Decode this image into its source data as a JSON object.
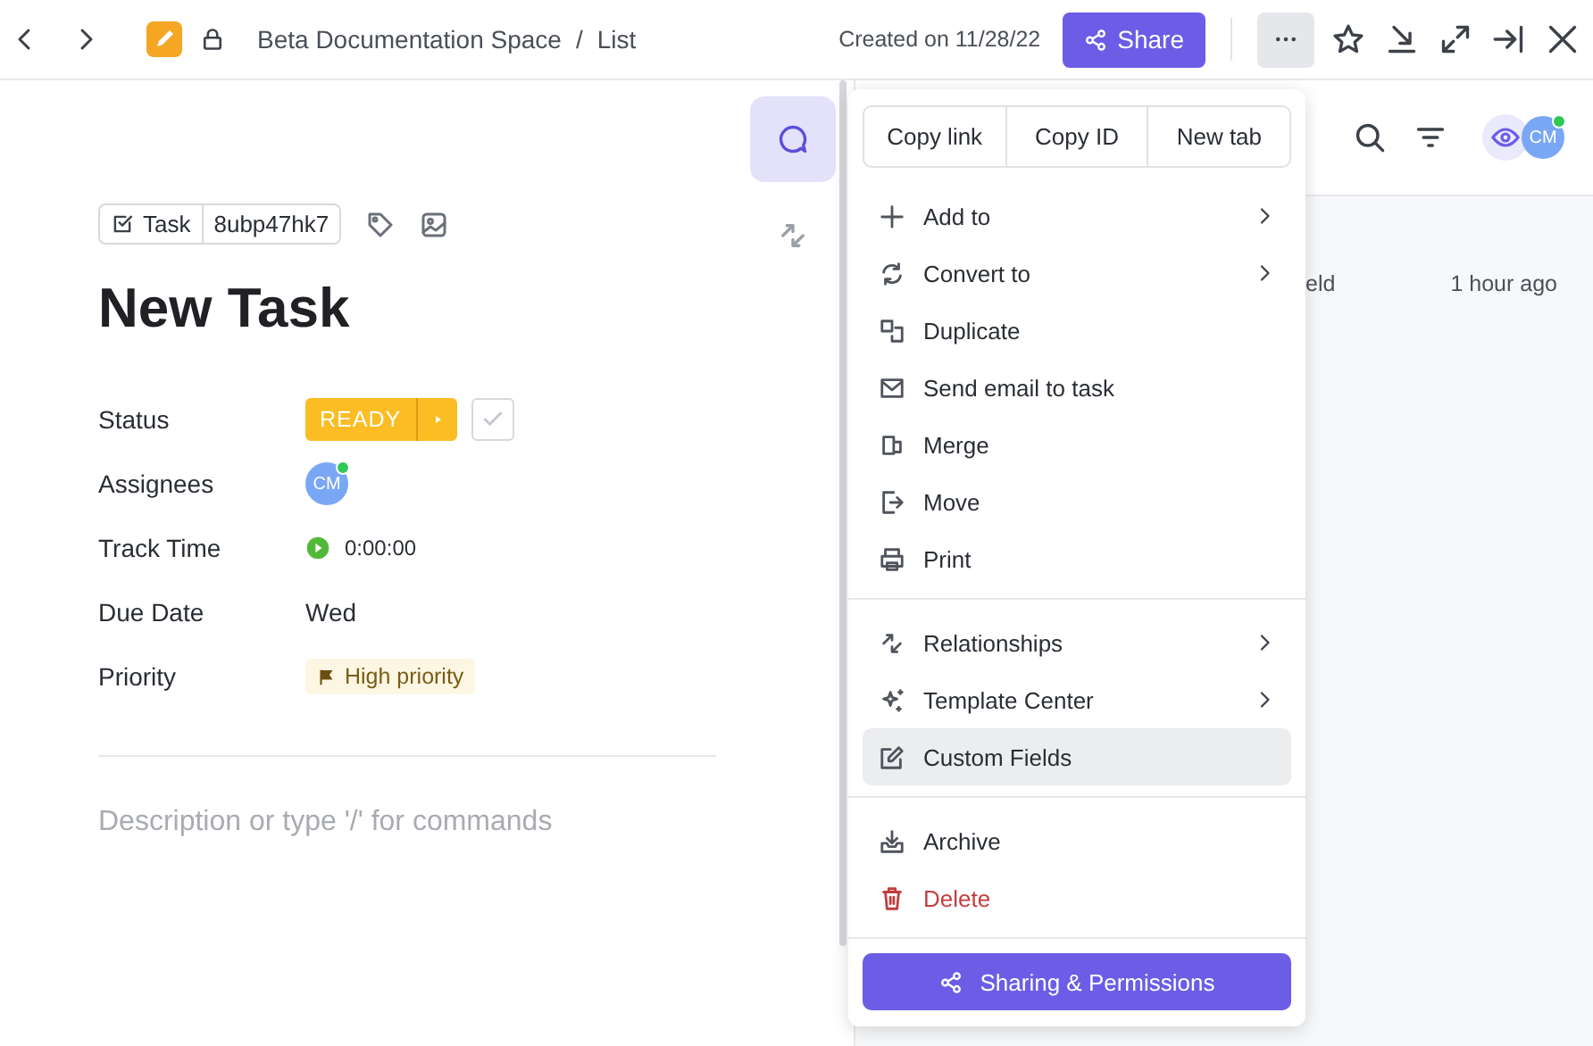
{
  "topbar": {
    "breadcrumb": [
      "Beta Documentation Space",
      "List"
    ],
    "separator": "/",
    "created": "Created on 11/28/22",
    "share": "Share",
    "more_active": true
  },
  "task": {
    "type": "Task",
    "id": "8ubp47hk7",
    "title": "New Task",
    "fields": [
      {
        "kind": "status",
        "label": "Status",
        "value": "READY"
      },
      {
        "kind": "assignee",
        "label": "Assignees",
        "value": "CM"
      },
      {
        "kind": "timer",
        "label": "Track Time",
        "value": "0:00:00"
      },
      {
        "kind": "text",
        "label": "Due Date",
        "value": "Wed"
      },
      {
        "kind": "priority",
        "label": "Priority",
        "value": "High priority"
      }
    ],
    "description": {
      "placeholder": "Description or type '/' for commands"
    }
  },
  "side": {
    "avatar": "CM",
    "activity": {
      "column_1": "eld",
      "time": "1 hour ago"
    }
  },
  "menu": {
    "quick_actions": [
      "Copy link",
      "Copy ID",
      "New tab"
    ],
    "sections": [
      [
        {
          "label": "Add to",
          "submenu": true,
          "selected": false,
          "kind": "normal"
        },
        {
          "label": "Convert to",
          "submenu": true,
          "selected": false,
          "kind": "normal"
        },
        {
          "label": "Duplicate",
          "submenu": false,
          "selected": false,
          "kind": "normal"
        },
        {
          "label": "Send email to task",
          "submenu": false,
          "selected": false,
          "kind": "normal"
        },
        {
          "label": "Merge",
          "submenu": false,
          "selected": false,
          "kind": "normal"
        },
        {
          "label": "Move",
          "submenu": false,
          "selected": false,
          "kind": "normal"
        },
        {
          "label": "Print",
          "submenu": false,
          "selected": false,
          "kind": "normal"
        }
      ],
      [
        {
          "label": "Relationships",
          "submenu": true,
          "selected": false,
          "kind": "normal"
        },
        {
          "label": "Template Center",
          "submenu": true,
          "selected": false,
          "kind": "normal"
        },
        {
          "label": "Custom Fields",
          "submenu": false,
          "selected": true,
          "kind": "normal"
        }
      ],
      [
        {
          "label": "Archive",
          "submenu": false,
          "selected": false,
          "kind": "normal"
        },
        {
          "label": "Delete",
          "submenu": false,
          "selected": false,
          "kind": "danger"
        }
      ]
    ],
    "primary": "Sharing & Permissions"
  }
}
